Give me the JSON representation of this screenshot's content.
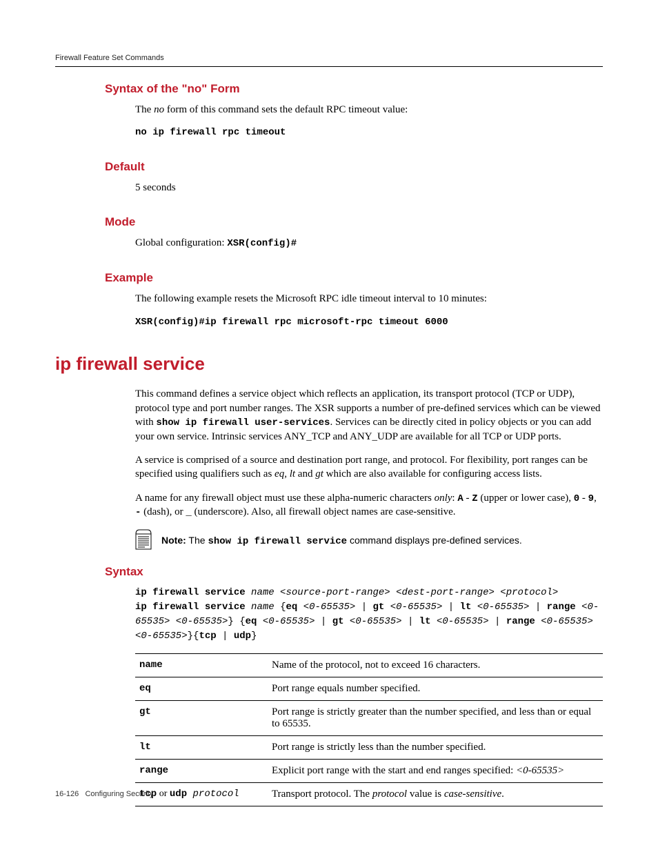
{
  "header": {
    "running_title": "Firewall Feature Set Commands"
  },
  "sections": {
    "syntax_no_form": {
      "heading": "Syntax of the \"no\" Form",
      "intro_pre": "The ",
      "intro_em": "no",
      "intro_post": " form of this command sets the default RPC timeout value:",
      "code": "no ip firewall rpc timeout"
    },
    "default": {
      "heading": "Default",
      "body": "5 seconds"
    },
    "mode": {
      "heading": "Mode",
      "body_pre": "Global configuration: ",
      "body_code": "XSR(config)#"
    },
    "example": {
      "heading": "Example",
      "body": "The following example resets the Microsoft RPC idle timeout interval to 10 minutes:",
      "code": "XSR(config)#ip firewall rpc microsoft-rpc timeout 6000"
    }
  },
  "main": {
    "heading": "ip firewall service",
    "p1_a": "This command defines a service object which reflects an application, its transport protocol (TCP or UDP), protocol type and port number ranges. The XSR supports a number of pre-defined services which can be viewed with ",
    "p1_code": "show ip firewall user-services",
    "p1_b": ". Services can be directly cited in policy objects or you can add your own service. Intrinsic services ANY_TCP and ANY_UDP are available for all TCP or UDP ports.",
    "p2_a": "A service is comprised of a source and destination port range, and protocol. For flexibility, port ranges can be specified using qualifiers such as ",
    "p2_em1": "eq",
    "p2_b": ", ",
    "p2_em2": "lt",
    "p2_c": " and ",
    "p2_em3": "gt",
    "p2_d": " which are also available for configuring access lists.",
    "p3_a": "A name for any firewall object must use these alpha-numeric characters ",
    "p3_em": "only",
    "p3_b": ": ",
    "p3_code1": "A",
    "p3_c": " - ",
    "p3_code2": "Z",
    "p3_d": " (upper or lower case), ",
    "p3_code3": "0",
    "p3_e": " - ",
    "p3_code4": "9",
    "p3_f": ", ",
    "p3_code5": "-",
    "p3_g": " (dash), or ",
    "p3_code6": "_",
    "p3_h": " (underscore). Also, all firewall object names are case-sensitive.",
    "note_label": "Note:",
    "note_a": " The ",
    "note_code": "show ip firewall service",
    "note_b": " command displays pre-defined services."
  },
  "syntax2": {
    "heading": "Syntax",
    "line1_cmd": "ip firewall service",
    "line1_args": " name <source-port-range> <dest-port-range> <protocol>",
    "line2_cmd": "ip firewall service",
    "line2_name": " name ",
    "line2_rest": "{eq <0-65535> | gt <0-65535> | lt <0-65535> | range <0-65535> <0-65535>} {eq <0-65535> | gt <0-65535> | lt <0-65535> | range <0-65535> <0-65535>}{tcp | udp}"
  },
  "params": [
    {
      "key": "name",
      "desc_a": "Name of the protocol, not to exceed 16 characters."
    },
    {
      "key": "eq",
      "desc_a": "Port range equals number specified."
    },
    {
      "key": "gt",
      "desc_a": "Port range is strictly greater than the number specified, and less than or equal to 65535."
    },
    {
      "key": "lt",
      "desc_a": "Port range is strictly less than the number specified."
    },
    {
      "key": "range",
      "desc_a": "Explicit port range with the start and end ranges specified: ",
      "desc_em": "<0-65535>"
    },
    {
      "key_html": "tcp_or_udp",
      "desc_a": "Transport protocol. The ",
      "desc_em1": "protocol",
      "desc_b": " value is ",
      "desc_em2": "case-sensitive",
      "desc_c": "."
    }
  ],
  "special_key": {
    "tcp": "tcp",
    "or": " or ",
    "udp": "udp",
    "proto": " protocol"
  },
  "footer": {
    "page": "16-126",
    "label": "Configuring Security"
  }
}
